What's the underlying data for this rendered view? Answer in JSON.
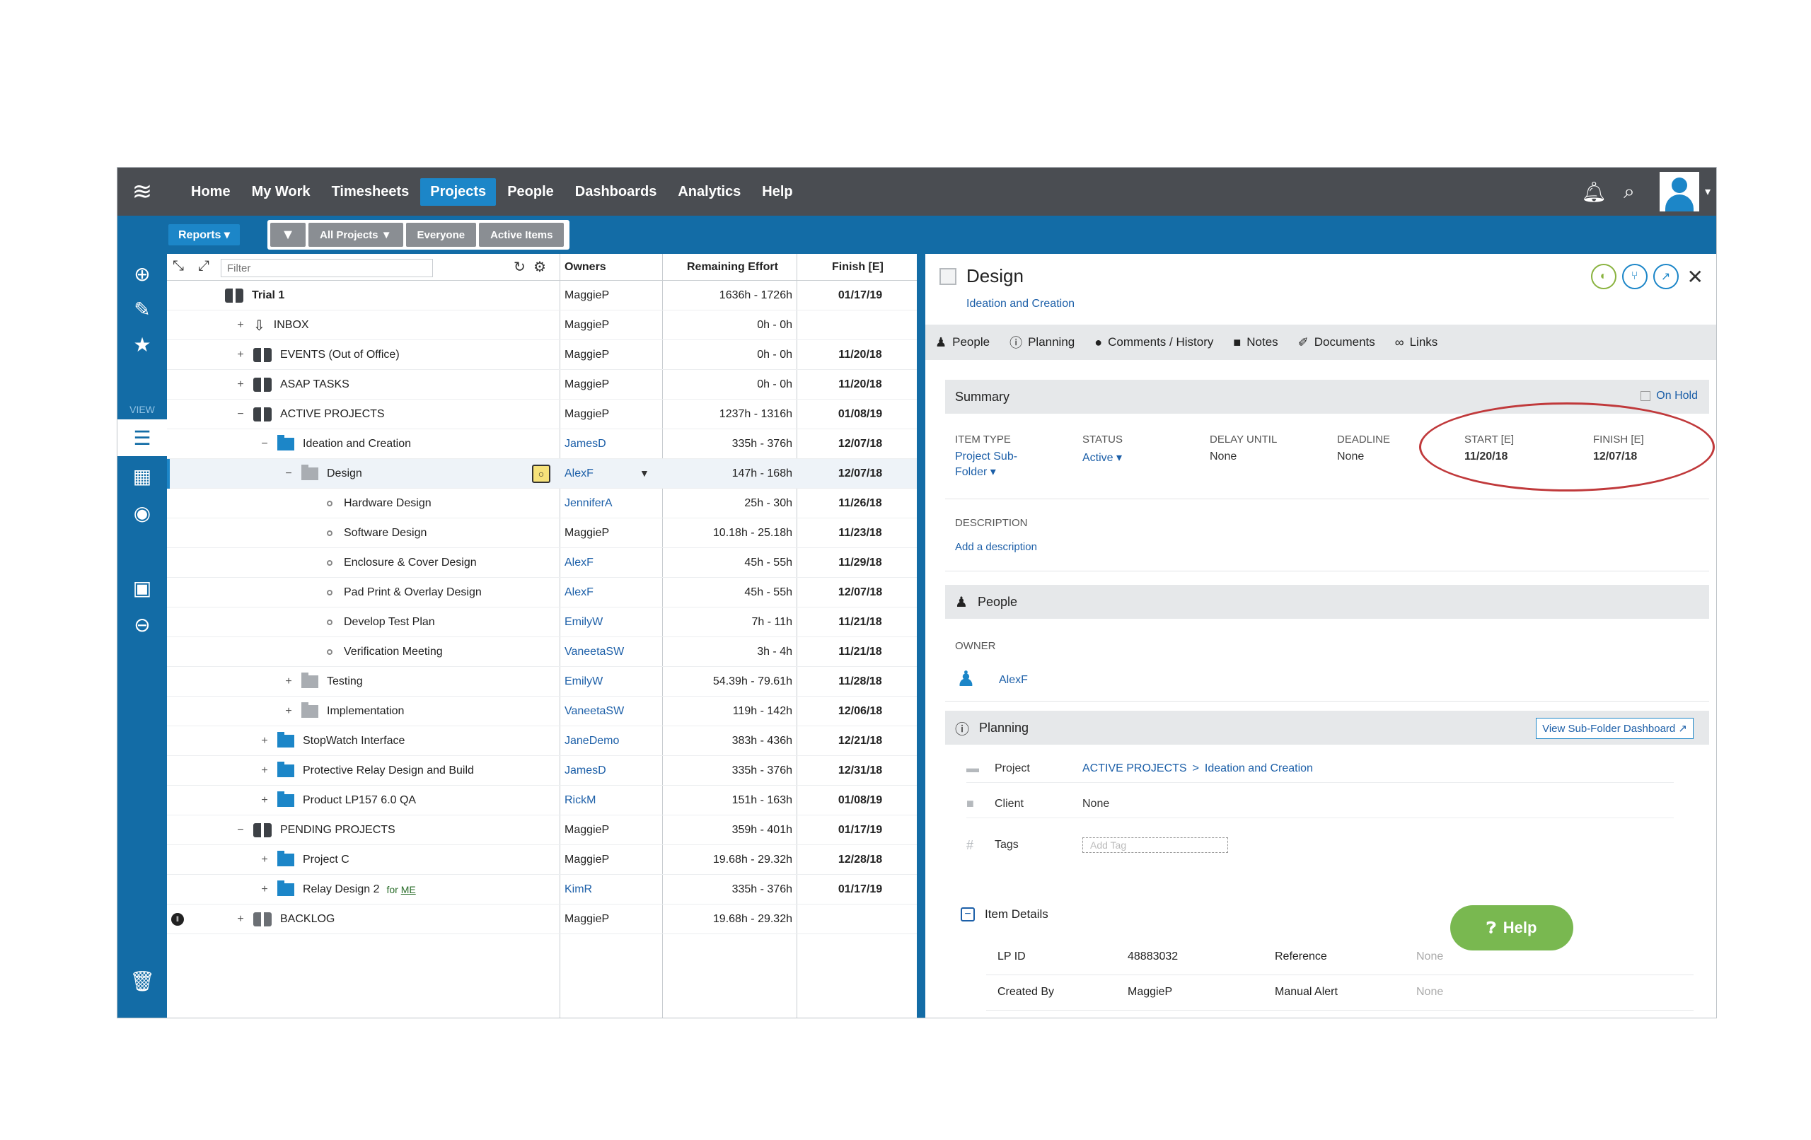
{
  "nav": {
    "items": [
      "Home",
      "My Work",
      "Timesheets",
      "Projects",
      "People",
      "Dashboards",
      "Analytics",
      "Help"
    ],
    "active": "Projects"
  },
  "subbar": {
    "reports": "Reports ▾",
    "filters": [
      "All Projects ▼",
      "Everyone",
      "Active Items"
    ]
  },
  "rail": {
    "view_label": "VIEW"
  },
  "tree": {
    "filter_placeholder": "Filter",
    "columns": {
      "owners": "Owners",
      "effort": "Remaining Effort",
      "finish": "Finish [E]"
    },
    "rows": [
      {
        "name": "Trial 1",
        "owner": "MaggieP",
        "effort": "1636h - 1726h",
        "finish": "01/17/19"
      },
      {
        "name": "INBOX",
        "owner": "MaggieP",
        "effort": "0h - 0h",
        "finish": ""
      },
      {
        "name": "EVENTS (Out of Office)",
        "owner": "MaggieP",
        "effort": "0h - 0h",
        "finish": "11/20/18"
      },
      {
        "name": "ASAP TASKS",
        "owner": "MaggieP",
        "effort": "0h - 0h",
        "finish": "11/20/18"
      },
      {
        "name": "ACTIVE PROJECTS",
        "owner": "MaggieP",
        "effort": "1237h - 1316h",
        "finish": "01/08/19"
      },
      {
        "name": "Ideation and Creation",
        "owner": "JamesD",
        "effort": "335h - 376h",
        "finish": "12/07/18"
      },
      {
        "name": "Design",
        "owner": "AlexF",
        "effort": "147h - 168h",
        "finish": "12/07/18"
      },
      {
        "name": "Hardware Design",
        "owner": "JenniferA",
        "effort": "25h - 30h",
        "finish": "11/26/18"
      },
      {
        "name": "Software Design",
        "owner": "MaggieP",
        "effort": "10.18h - 25.18h",
        "finish": "11/23/18"
      },
      {
        "name": "Enclosure & Cover Design",
        "owner": "AlexF",
        "effort": "45h - 55h",
        "finish": "11/29/18"
      },
      {
        "name": "Pad Print & Overlay Design",
        "owner": "AlexF",
        "effort": "45h - 55h",
        "finish": "12/07/18"
      },
      {
        "name": "Develop Test Plan",
        "owner": "EmilyW",
        "effort": "7h - 11h",
        "finish": "11/21/18"
      },
      {
        "name": "Verification Meeting",
        "owner": "VaneetaSW",
        "effort": "3h - 4h",
        "finish": "11/21/18"
      },
      {
        "name": "Testing",
        "owner": "EmilyW",
        "effort": "54.39h - 79.61h",
        "finish": "11/28/18"
      },
      {
        "name": "Implementation",
        "owner": "VaneetaSW",
        "effort": "119h - 142h",
        "finish": "12/06/18"
      },
      {
        "name": "StopWatch Interface",
        "owner": "JaneDemo",
        "effort": "383h - 436h",
        "finish": "12/21/18"
      },
      {
        "name": "Protective Relay Design and Build",
        "owner": "JamesD",
        "effort": "335h - 376h",
        "finish": "12/31/18"
      },
      {
        "name": "Product LP157 6.0 QA",
        "owner": "RickM",
        "effort": "151h - 163h",
        "finish": "01/08/19"
      },
      {
        "name": "PENDING PROJECTS",
        "owner": "MaggieP",
        "effort": "359h - 401h",
        "finish": "01/17/19"
      },
      {
        "name": "Project C",
        "owner": "MaggieP",
        "effort": "19.68h - 29.32h",
        "finish": "12/28/18"
      },
      {
        "name": "Relay Design 2",
        "owner": "KimR",
        "effort": "335h - 376h",
        "finish": "01/17/19",
        "tag_prefix": "for",
        "tag": "ME"
      },
      {
        "name": "BACKLOG",
        "owner": "MaggieP",
        "effort": "19.68h - 29.32h",
        "finish": ""
      }
    ]
  },
  "detail": {
    "title": "Design",
    "subtitle": "Ideation and Creation",
    "tabs": [
      "People",
      "Planning",
      "Comments / History",
      "Notes",
      "Documents",
      "Links"
    ],
    "summary": {
      "header": "Summary",
      "on_hold": "On Hold",
      "item_type_label": "ITEM TYPE",
      "item_type_value_line1": "Project Sub-",
      "item_type_value_line2": "Folder ▾",
      "status_label": "STATUS",
      "status_value": "Active ▾",
      "delay_label": "DELAY UNTIL",
      "delay_value": "None",
      "deadline_label": "DEADLINE",
      "deadline_value": "None",
      "start_label": "START [E]",
      "start_value": "11/20/18",
      "finish_label": "FINISH [E]",
      "finish_value": "12/07/18",
      "description_label": "DESCRIPTION",
      "add_description": "Add a description"
    },
    "people": {
      "header": "People",
      "owner_label": "OWNER",
      "owner_value": "AlexF"
    },
    "planning": {
      "header": "Planning",
      "dashboard_link": "View Sub-Folder Dashboard ↗",
      "project_label": "Project",
      "project_path_1": "ACTIVE PROJECTS",
      "project_sep": ">",
      "project_path_2": "Ideation and Creation",
      "client_label": "Client",
      "client_value": "None",
      "tags_label": "Tags",
      "add_tag": "Add Tag"
    },
    "item_details": {
      "header": "Item Details",
      "rows": [
        {
          "k1": "LP ID",
          "v1": "48883032",
          "k2": "Reference",
          "v2": "None"
        },
        {
          "k1": "Created By",
          "v1": "MaggieP",
          "k2": "Manual Alert",
          "v2": "None"
        }
      ]
    }
  },
  "help_button": "Help",
  "colors": {
    "nav_bg": "#4a4d52",
    "brand_blue": "#136ca6",
    "accent_blue": "#1c86c8",
    "help_green": "#79b850",
    "highlight_red": "#c0393b"
  }
}
